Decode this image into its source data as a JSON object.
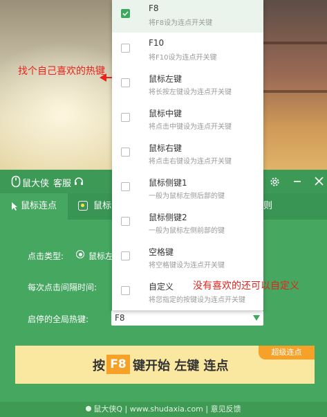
{
  "annotations": {
    "left_note": "找个自己喜欢的热键",
    "right_note": "没有喜欢的还可以自定义"
  },
  "titlebar": {
    "app_name": "鼠大侠",
    "service": "客服"
  },
  "tabs": [
    {
      "label": "鼠标连点"
    },
    {
      "label": "鼠标"
    },
    {
      "label": "则"
    }
  ],
  "form": {
    "click_type_label": "点击类型:",
    "click_type_option": "鼠标左",
    "interval_label": "每次点击间隔时间:",
    "hotkey_label": "启停的全局热键:",
    "hotkey_value": "F8"
  },
  "banner": {
    "prefix": "按",
    "key": "F8",
    "suffix": "键开始 左键 连点",
    "badge": "超级连点"
  },
  "footer": {
    "text": "鼠大侠Q | www.shudaxia.com | 意见反馈"
  },
  "dropdown": {
    "options": [
      {
        "title": "F8",
        "desc": "将F8设为连点开关键",
        "checked": true
      },
      {
        "title": "F10",
        "desc": "将F10设为连点开关键",
        "checked": false
      },
      {
        "title": "鼠标左键",
        "desc": "将长按左键设为连点开关键",
        "checked": false
      },
      {
        "title": "鼠标中键",
        "desc": "将点击中键设为连点开关键",
        "checked": false
      },
      {
        "title": "鼠标右键",
        "desc": "将点击右键设为连点开关键",
        "checked": false
      },
      {
        "title": "鼠标侧键1",
        "desc": "一般为鼠标左侧后部的键",
        "checked": false
      },
      {
        "title": "鼠标侧键2",
        "desc": "一般为鼠标左侧前部的键",
        "checked": false
      },
      {
        "title": "空格键",
        "desc": "将空格键设为连点开关键",
        "checked": false
      },
      {
        "title": "自定义",
        "desc": "将您指定的按键设为连点开关键",
        "checked": false
      }
    ]
  },
  "colors": {
    "primary_green": "#45a760",
    "dark_green": "#3d9a56",
    "accent_orange": "#f6a128",
    "annotation_red": "#e8231b"
  }
}
